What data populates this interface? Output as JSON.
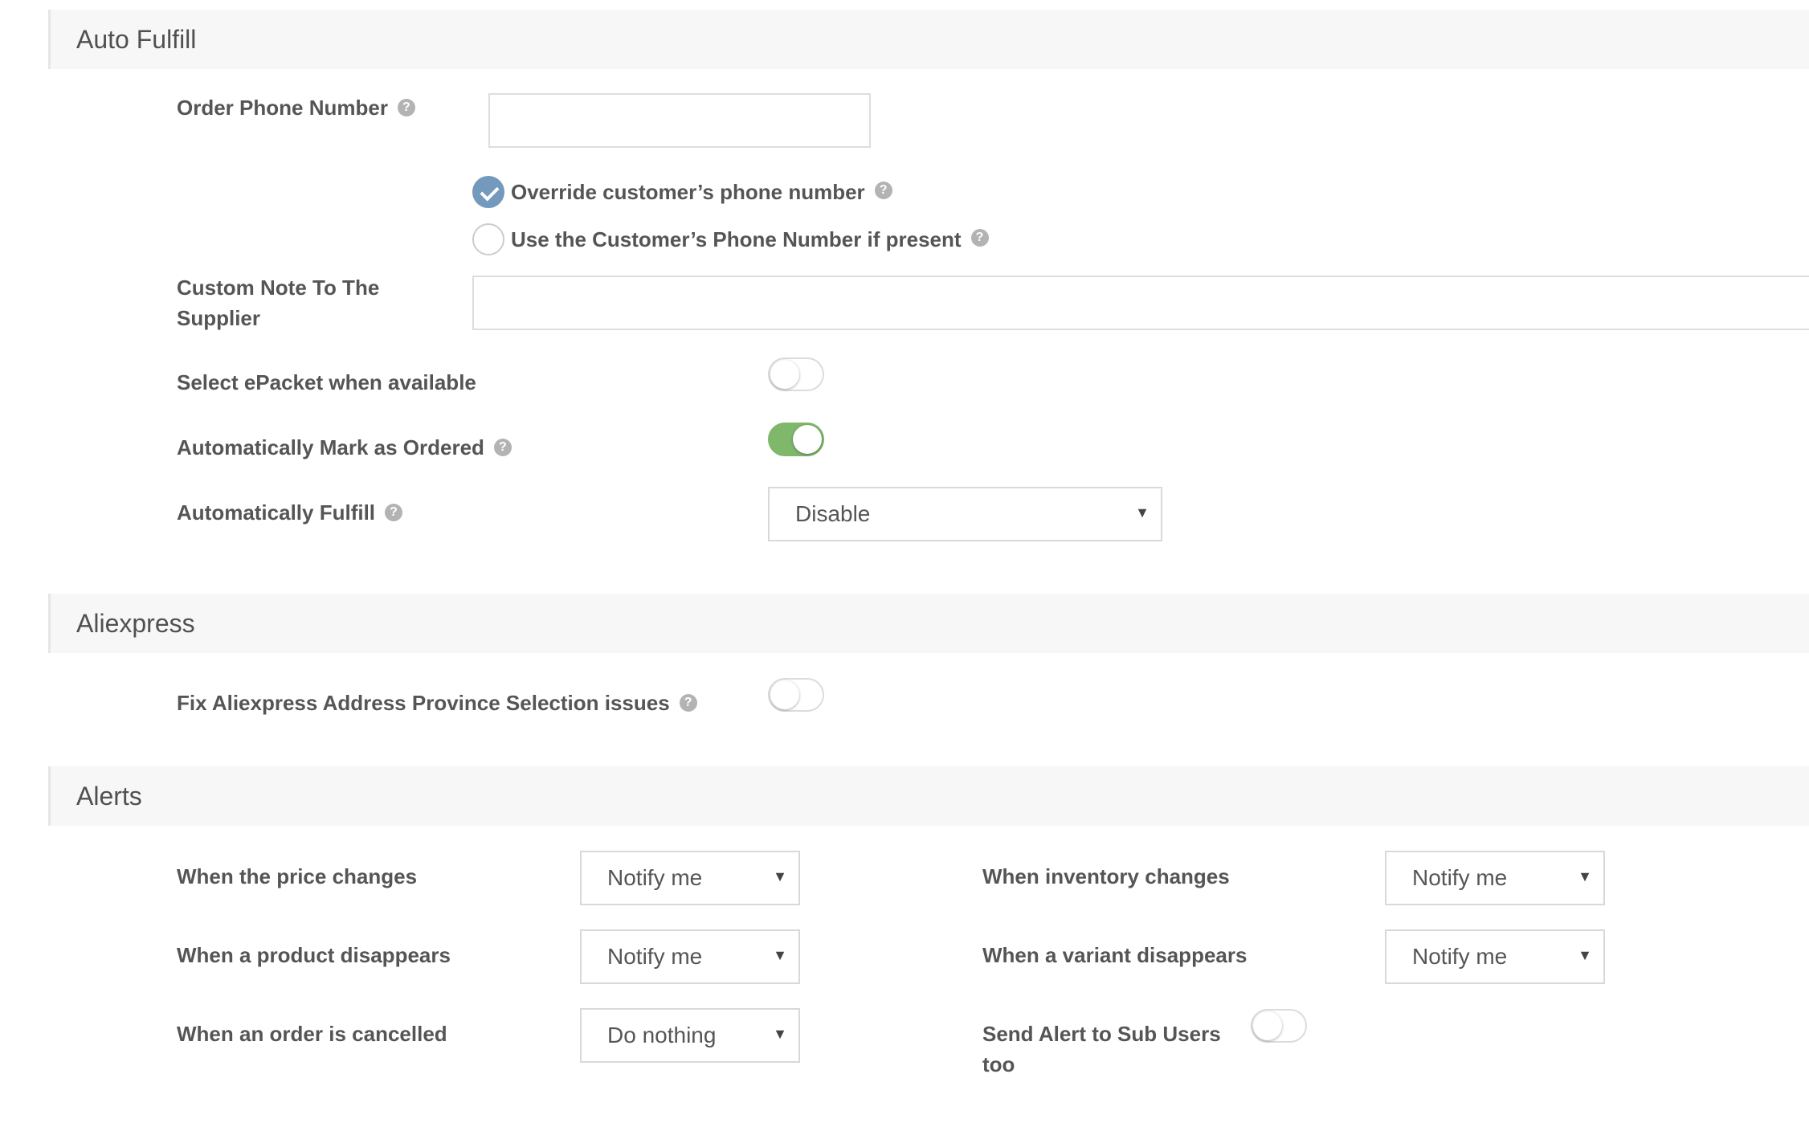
{
  "sections": {
    "auto_fulfill": "Auto Fulfill",
    "aliexpress": "Aliexpress",
    "alerts": "Alerts"
  },
  "auto_fulfill": {
    "order_phone_label": "Order Phone Number",
    "order_phone_value": "",
    "override_label": "Override customer’s phone number",
    "override_checked": true,
    "use_customer_label": "Use the Customer’s Phone Number if present",
    "use_customer_checked": false,
    "custom_note_label": "Custom Note To The Supplier",
    "custom_note_value": "",
    "epacket_label": "Select ePacket when available",
    "epacket_on": false,
    "mark_ordered_label": "Automatically Mark as Ordered",
    "mark_ordered_on": true,
    "auto_fulfill_label": "Automatically Fulfill",
    "auto_fulfill_value": "Disable"
  },
  "aliexpress": {
    "fix_province_label": "Fix Aliexpress Address Province Selection issues",
    "fix_province_on": false
  },
  "alerts": {
    "price_changes_label": "When the price changes",
    "price_changes_value": "Notify me",
    "inventory_changes_label": "When inventory changes",
    "inventory_changes_value": "Notify me",
    "product_disappears_label": "When a product disappears",
    "product_disappears_value": "Notify me",
    "variant_disappears_label": "When a variant disappears",
    "variant_disappears_value": "Notify me",
    "order_cancelled_label": "When an order is cancelled",
    "order_cancelled_value": "Do nothing",
    "sub_users_label": "Send Alert to Sub Users too",
    "sub_users_on": false
  },
  "icons": {
    "help": "?",
    "caret": "▼"
  },
  "colors": {
    "radio_checked": "#7399bd",
    "toggle_on": "#7fb76b",
    "section_bg": "#f7f7f7"
  }
}
